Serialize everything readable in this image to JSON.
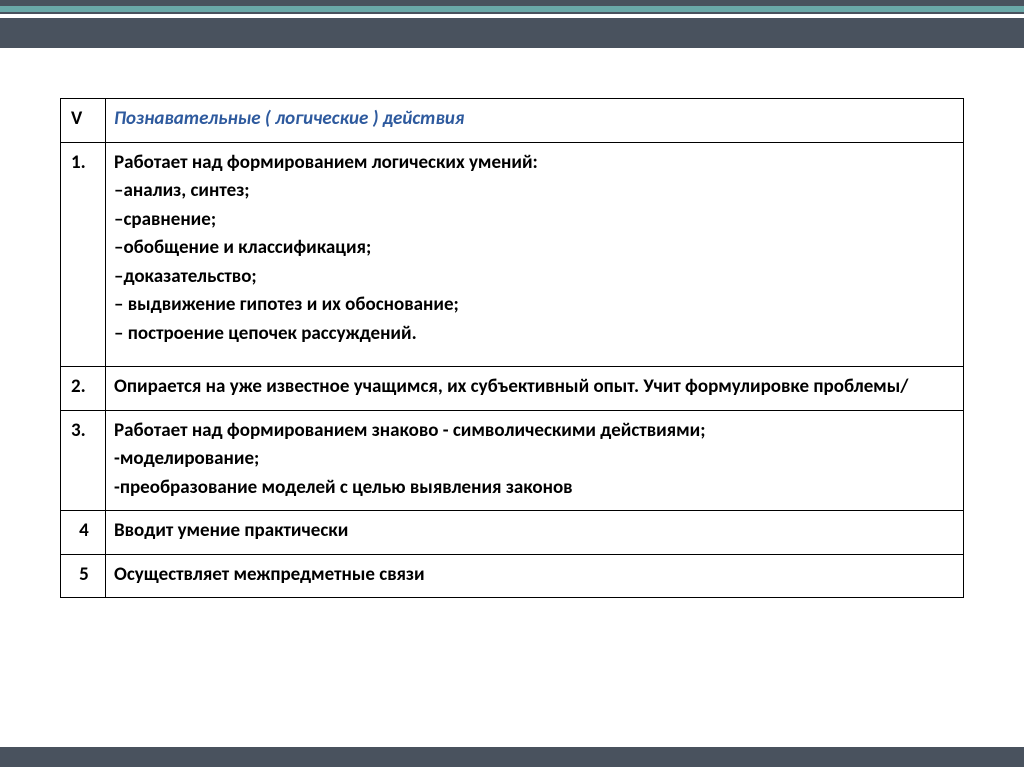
{
  "header": {
    "num": "V",
    "title": "  Познавательные ( логические   ) действия"
  },
  "rows": [
    {
      "num": "1.",
      "lines": [
        "Работает над формированием  логических умений:",
        "–анализ, синтез;",
        "–сравнение;",
        "–обобщение и классификация;",
        "–доказательство;",
        "– выдвижение гипотез и их обоснование;",
        "– построение цепочек рассуждений."
      ]
    },
    {
      "num": "2.",
      "lines": [
        "Опирается на уже известное учащимся, их субъективный опыт. Учит формулировке проблемы/"
      ]
    },
    {
      "num": "3.",
      "lines": [
        "Работает над формированием знаково - символическими действиями;",
        "-моделирование;",
        "-преобразование моделей с целью выявления законов"
      ]
    },
    {
      "num": "4",
      "lines": [
        "Вводит умение практически"
      ]
    },
    {
      "num": "5",
      "lines": [
        "Осуществляет межпредметные связи"
      ]
    }
  ]
}
